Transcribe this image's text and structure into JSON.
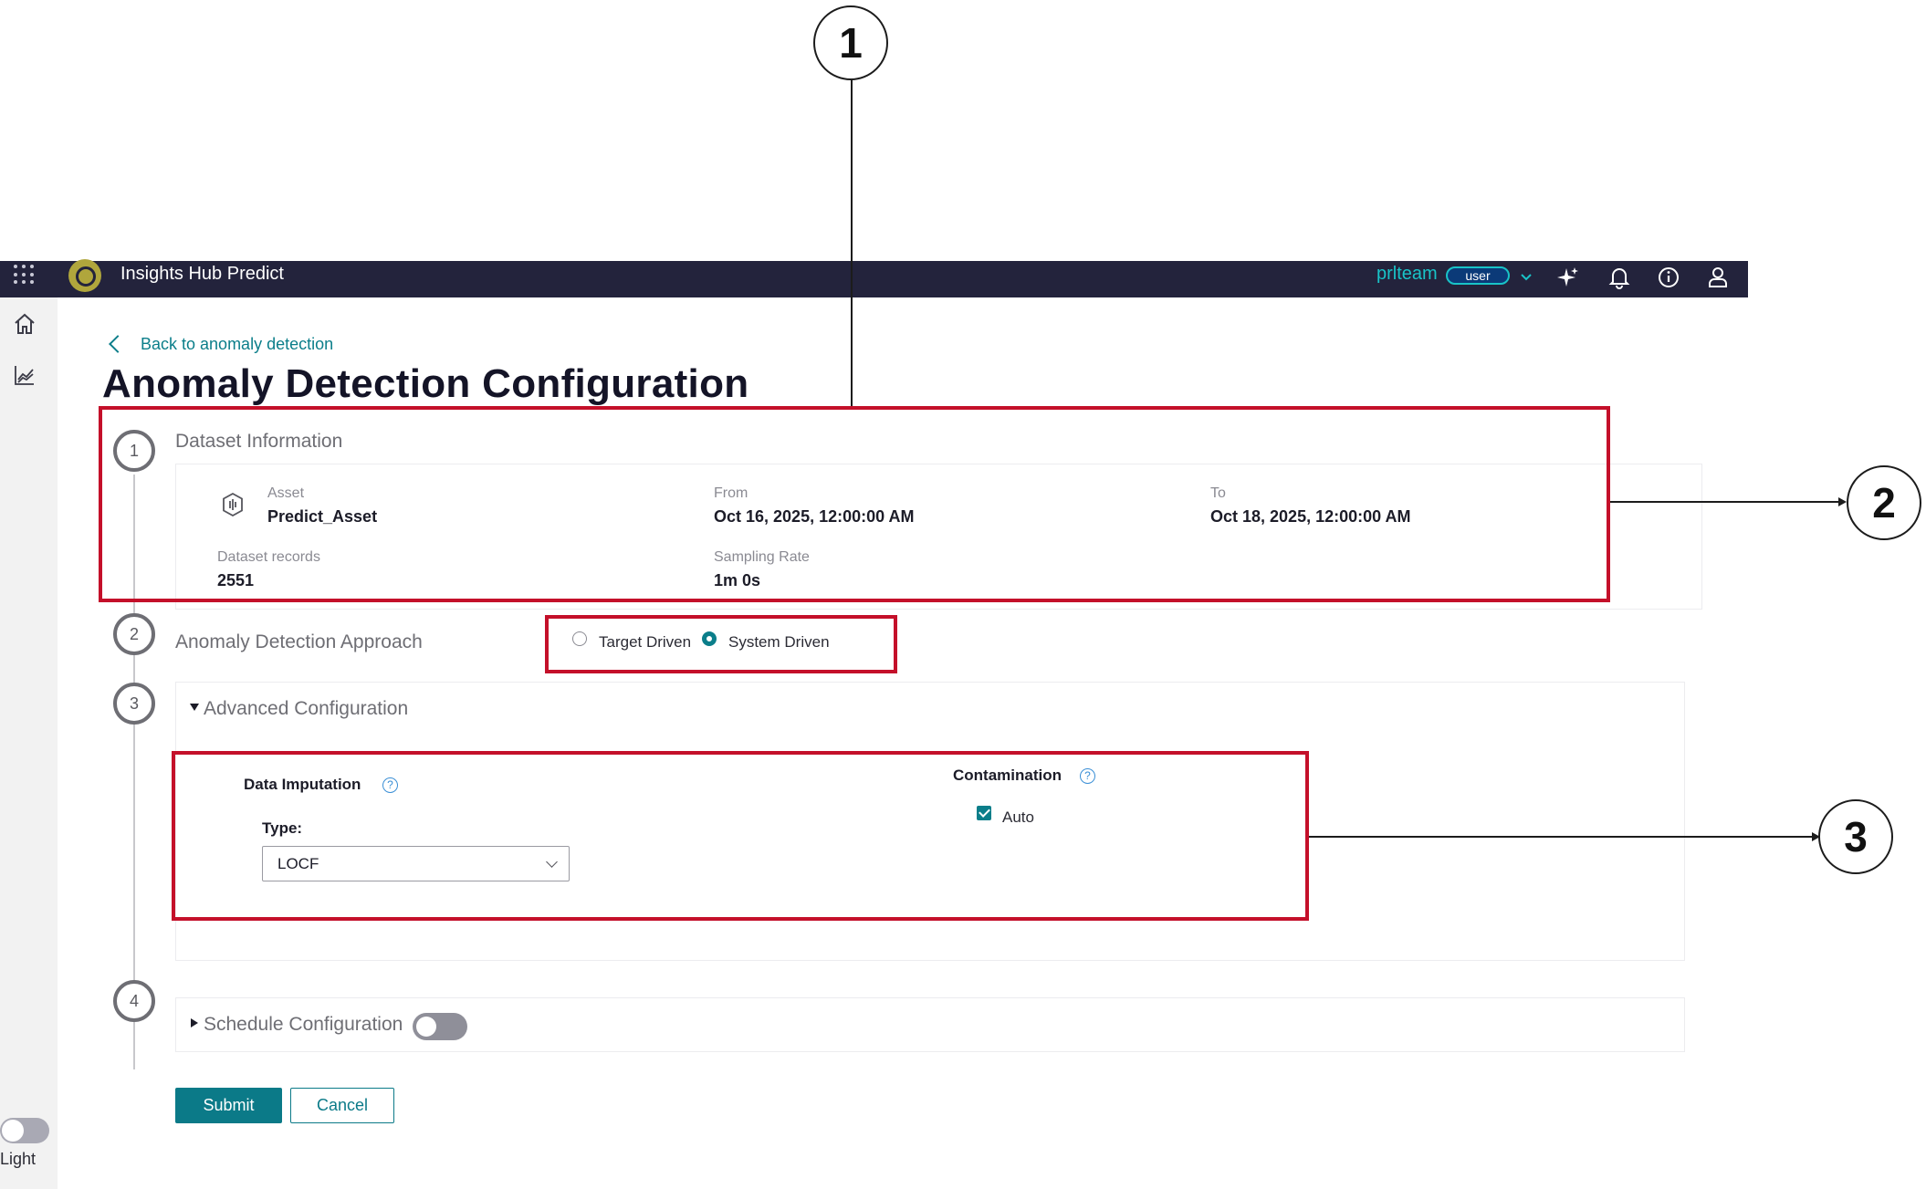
{
  "header": {
    "app_title": "Insights Hub Predict",
    "tenant": "prlteam",
    "role": "user"
  },
  "sidenav": {
    "theme_label": "Light"
  },
  "page": {
    "back_link": "Back to anomaly detection",
    "title": "Anomaly Detection Configuration"
  },
  "steps": [
    "1",
    "2",
    "3",
    "4"
  ],
  "dataset": {
    "title": "Dataset Information",
    "asset_label": "Asset",
    "asset_value": "Predict_Asset",
    "from_label": "From",
    "from_value": "Oct 16, 2025, 12:00:00 AM",
    "to_label": "To",
    "to_value": "Oct 18, 2025, 12:00:00 AM",
    "records_label": "Dataset records",
    "records_value": "2551",
    "sampling_label": "Sampling Rate",
    "sampling_value": "1m 0s"
  },
  "approach": {
    "title": "Anomaly Detection Approach",
    "options": [
      "Target Driven",
      "System Driven"
    ],
    "selected": "System Driven"
  },
  "advanced": {
    "title": "Advanced Configuration",
    "imputation_label": "Data Imputation",
    "type_label": "Type:",
    "type_value": "LOCF",
    "contamination_label": "Contamination",
    "auto_label": "Auto",
    "auto_checked": true
  },
  "schedule": {
    "title": "Schedule Configuration",
    "enabled": false
  },
  "actions": {
    "submit": "Submit",
    "cancel": "Cancel"
  },
  "callouts": [
    "1",
    "2",
    "3"
  ],
  "colors": {
    "topbar": "#23233c",
    "accent": "#0b7a88",
    "tenant": "#19c3c7",
    "highlight": "#c4102a"
  },
  "icons": [
    "app-menu-icon",
    "app-logo-icon",
    "chevron-down-icon",
    "sparkle-icon",
    "bell-icon",
    "info-icon",
    "user-icon",
    "home-icon",
    "chart-icon",
    "asset-icon",
    "help-icon",
    "chevron-left-icon"
  ]
}
